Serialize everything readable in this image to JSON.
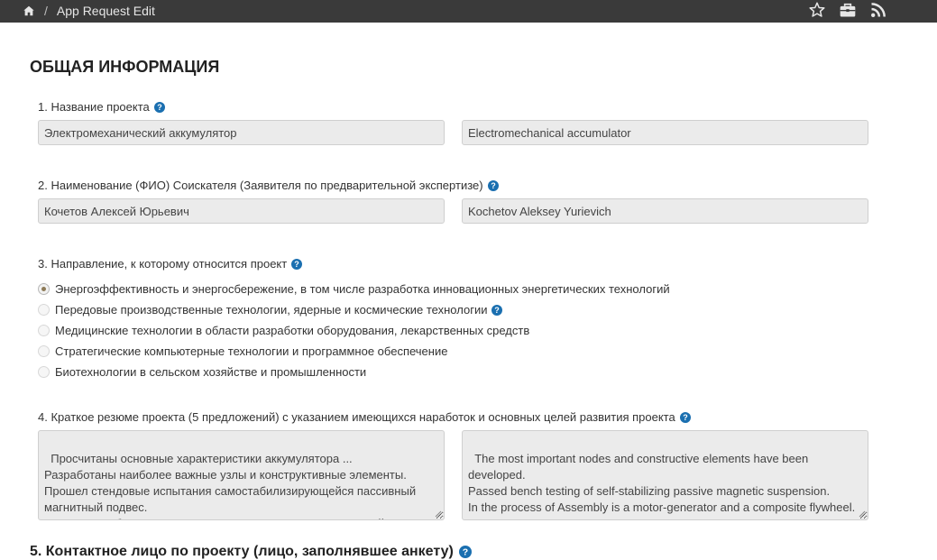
{
  "header": {
    "breadcrumb_separator": "/",
    "breadcrumb_current": "App Request Edit",
    "icons": [
      "home-icon",
      "star-icon",
      "briefcase-icon",
      "rss-icon"
    ]
  },
  "section": {
    "title": "ОБЩАЯ ИНФОРМАЦИЯ"
  },
  "fields": {
    "project_name": {
      "label": "1. Название проекта",
      "value_ru": "Электромеханический аккумулятор",
      "value_en": "Electromechanical accumulator"
    },
    "applicant": {
      "label": "2. Наименование (ФИО) Соискателя (Заявителя по предварительной экспертизе)",
      "value_ru": "Кочетов Алексей Юрьевич",
      "value_en": "Kochetov Aleksey Yurievich"
    },
    "direction": {
      "label": "3. Направление, к которому относится проект",
      "options": [
        "Энергоэффективность и энергосбережение, в том числе разработка инновационных энергетических технологий",
        "Передовые производственные технологии, ядерные и космические технологии",
        "Медицинские технологии в области разработки оборудования, лекарственных средств",
        "Стратегические компьютерные технологии и программное обеспечение",
        "Биотехнологии в сельском хозяйстве и промышленности"
      ],
      "selected_index": 0
    },
    "summary": {
      "label": "4. Краткое резюме проекта (5 предложений) с указанием имеющихся наработок и основных целей развития проекта",
      "value_ru": "Просчитаны основные характеристики аккумулятора ...\nРазработаны наиболее важные узлы и конструктивные элементы.\nПрошел стендовые испытания самостабилизирующейся пассивный магнитный подвес.\nВ процессе сборки находится мотор-генератор и композитный маховик.",
      "value_en": "The most important nodes and constructive elements have been developed.\nPassed bench testing of self-stabilizing passive magnetic suspension.\nIn the process of Assembly is a motor-generator and a composite flywheel."
    }
  },
  "contact": {
    "title": "5. Контактное лицо по проекту (лицо, заполнявшее анкету)"
  },
  "colors": {
    "topbar": "#3a3a3a",
    "help_icon": "#1a6fb0",
    "input_bg": "#ebebeb",
    "radio_dot": "#8d7a57"
  }
}
